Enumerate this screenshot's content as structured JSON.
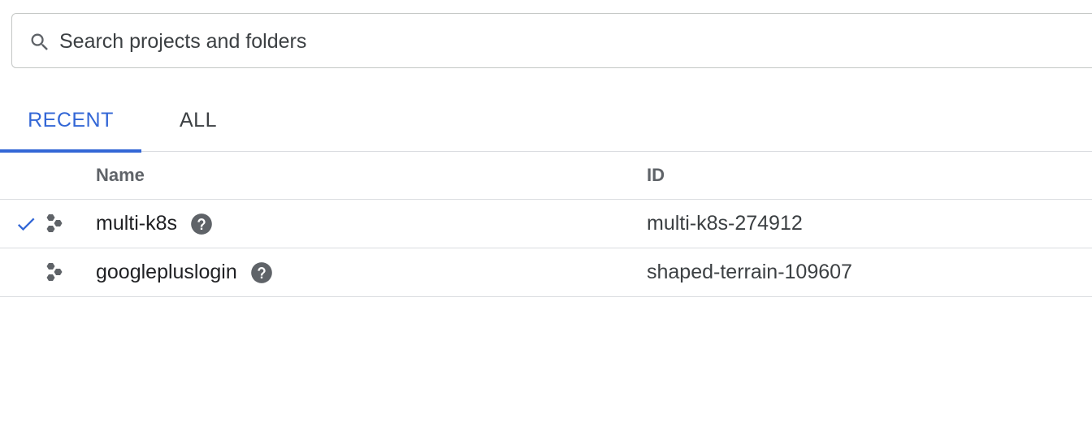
{
  "search": {
    "placeholder": "Search projects and folders",
    "value": "",
    "icon": "search-icon"
  },
  "tabs": [
    {
      "label": "RECENT",
      "active": true
    },
    {
      "label": "ALL",
      "active": false
    }
  ],
  "table": {
    "columns": {
      "name": "Name",
      "id": "ID"
    },
    "rows": [
      {
        "name": "multi-k8s",
        "id": "multi-k8s-274912",
        "selected": true
      },
      {
        "name": "googlepluslogin",
        "id": "shaped-terrain-109607",
        "selected": false
      }
    ]
  },
  "colors": {
    "accent": "#3367d6",
    "icon_gray": "#5f6368",
    "divider": "#dadce0"
  }
}
